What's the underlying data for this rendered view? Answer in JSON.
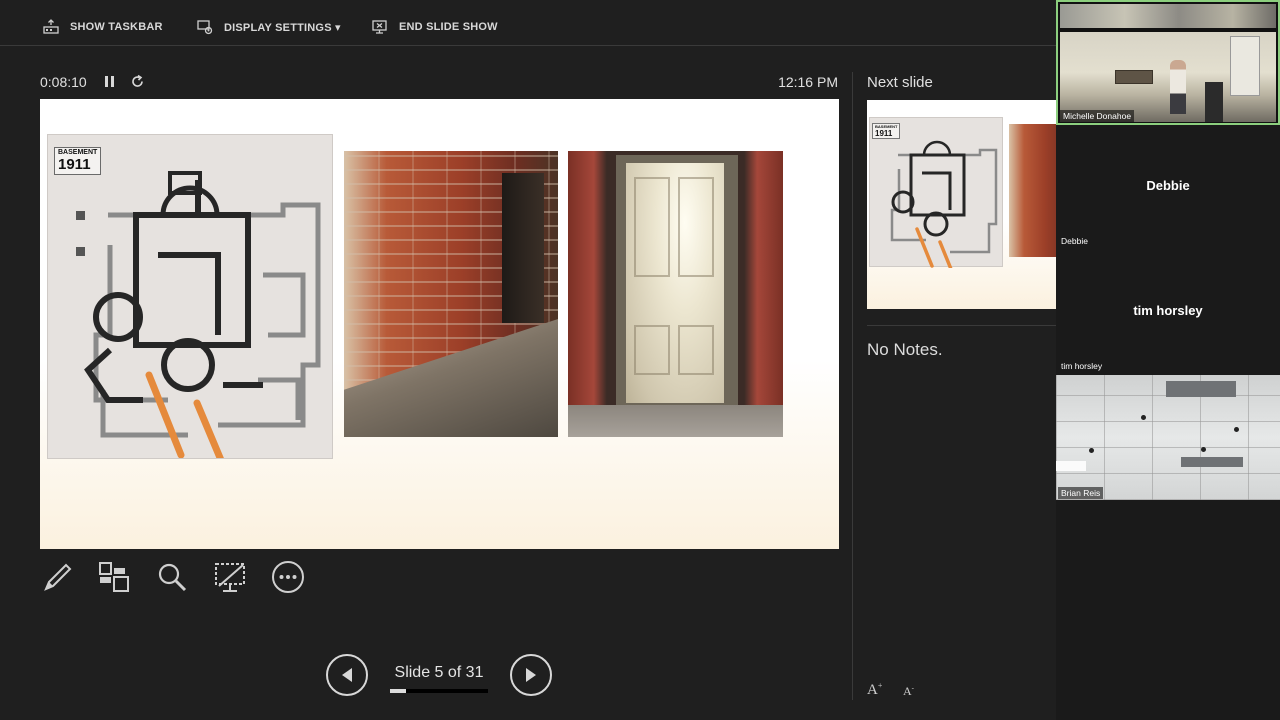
{
  "toolbar": {
    "show_taskbar": "SHOW TASKBAR",
    "display_settings": "DISPLAY SETTINGS ▾",
    "end_slide_show": "END SLIDE SHOW"
  },
  "timer": {
    "elapsed": "0:08:10",
    "clock": "12:16 PM"
  },
  "slide": {
    "plan_label_small": "BASEMENT",
    "plan_label_year": "1911"
  },
  "navigation": {
    "counter": "Slide 5 of 31",
    "current": 5,
    "total": 31
  },
  "next_slide": {
    "label": "Next slide",
    "plan_label_small": "BASEMENT",
    "plan_label_year": "1911"
  },
  "notes": {
    "text": "No Notes."
  },
  "participants": [
    {
      "tile_name": "Michelle Donahoe"
    },
    {
      "display_name": "Debbie",
      "tile_name": "Debbie"
    },
    {
      "display_name": "tim horsley",
      "tile_name": "tim horsley"
    },
    {
      "tile_name": "Brian Reis"
    }
  ],
  "icons": {
    "toolbar": [
      "taskbar-icon",
      "display-settings-icon",
      "end-show-icon"
    ],
    "timer": [
      "pause-icon",
      "restart-icon"
    ],
    "tools": [
      "pen-icon",
      "see-all-slides-icon",
      "zoom-icon",
      "black-screen-icon",
      "more-options-icon"
    ],
    "nav": [
      "previous-arrow-icon",
      "next-arrow-icon"
    ],
    "font": [
      "increase-font-icon",
      "decrease-font-icon"
    ]
  },
  "colors": {
    "background": "#1f1f1f",
    "accent_arrow": "#e58a3c",
    "active_speaker": "#8ccf7e"
  }
}
